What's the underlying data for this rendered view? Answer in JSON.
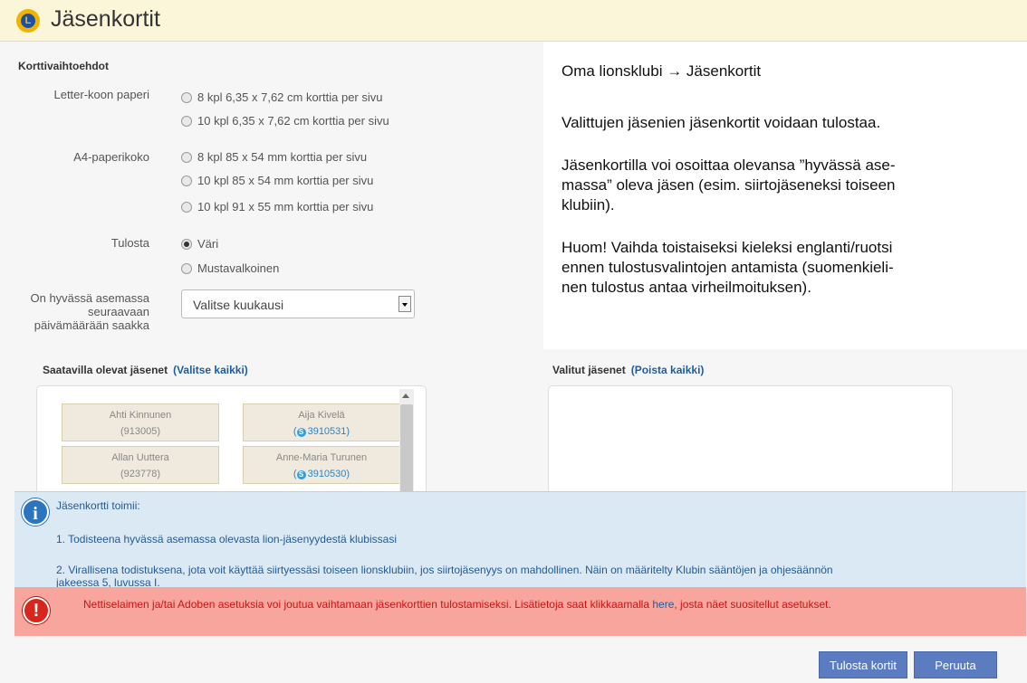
{
  "header": {
    "title": "Jäsenkortit",
    "logo_text": "L"
  },
  "form": {
    "section_title": "Korttivaihtoehdot",
    "letter": {
      "label": "Letter-koon paperi",
      "options": [
        "8 kpl 6,35 x 7,62 cm korttia per sivu",
        "10 kpl 6,35 x 7,62 cm korttia per sivu"
      ]
    },
    "a4": {
      "label": "A4-paperikoko",
      "options": [
        "8 kpl 85 x 54 mm korttia per sivu",
        "10 kpl 85 x 54 mm korttia per sivu",
        "10 kpl 91 x 55 mm korttia per sivu"
      ]
    },
    "print": {
      "label": "Tulosta",
      "options": [
        "Väri",
        "Mustavalkoinen"
      ],
      "selected": "Väri"
    },
    "date": {
      "label_lines": [
        "On hyvässä asemassa",
        "seuraavaan",
        "päivämäärään saakka"
      ],
      "select_value": "Valitse kuukausi"
    }
  },
  "note": {
    "lines": [
      "Oma lionsklubi → Jäsenkortit",
      "Valittujen jäsenien jäsenkortit voidaan tulostaa.",
      "Jäsenkortilla voi osoittaa olevansa ”hyvässä ase-",
      "massa” oleva jäsen (esim. siirtojäseneksi toiseen",
      "klubiin).",
      "Huom! Vaihda toistaiseksi kieleksi englanti/ruotsi",
      "ennen tulostusvalintojen antamista (suomenkieli-",
      "nen tulostus antaa virheilmoituksen)."
    ]
  },
  "available": {
    "title": "Saatavilla olevat jäsenet",
    "action": "(Valitse kaikki)",
    "members": [
      {
        "name": "Ahti Kinnunen",
        "id": "(913005)"
      },
      {
        "name": "Aija Kivelä",
        "id": "3910531"
      },
      {
        "name": "Allan Uuttera",
        "id": "(923778)"
      },
      {
        "name": "Anne-Maria Turunen",
        "id": "3910530"
      }
    ]
  },
  "selected": {
    "title": "Valitut jäsenet",
    "action": "(Poista kaikki)"
  },
  "info": {
    "title": "Jäsenkortti toimii:",
    "item1": "1. Todisteena hyvässä asemassa olevasta lion-jäsenyydestä klubissasi",
    "item2_line1": "2. Virallisena todistuksena, jota voit käyttää siirtyessäsi toiseen lionsklubiin, jos siirtojäsenyys on mahdollinen. Näin on määritelty Klubin sääntöjen ja ohjesäännön",
    "item2_line2": "jakeessa 5, luvussa I.",
    "icon": "i"
  },
  "warning": {
    "text_before": "Nettiselaimen ja/tai Adoben asetuksia voi joutua vaihtamaan jäsenkorttien tulostamiseksi. Lisätietoja saat klikkaamalla ",
    "link": "here",
    "text_after": ", josta näet suositellut asetukset.",
    "icon": "!"
  },
  "buttons": {
    "print": "Tulosta kortit",
    "cancel": "Peruuta"
  }
}
